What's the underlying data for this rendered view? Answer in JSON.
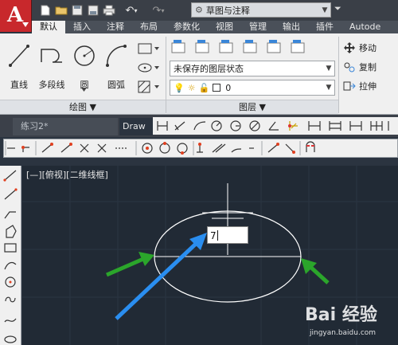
{
  "app": {
    "logo_letter": "A"
  },
  "quick_access": {
    "icons": [
      "new-file-icon",
      "open-folder-icon",
      "save-icon",
      "save-as-icon",
      "print-icon",
      "undo-icon",
      "redo-icon"
    ]
  },
  "workspace": {
    "value": "草图与注释"
  },
  "ribbon_tabs": [
    "默认",
    "插入",
    "注释",
    "布局",
    "参数化",
    "视图",
    "管理",
    "输出",
    "插件",
    "Autode"
  ],
  "draw_panel": {
    "tools": [
      "直线",
      "多段线",
      "圆",
      "圆弧"
    ],
    "title": "绘图 ▼"
  },
  "layers_panel": {
    "layer_state": "未保存的图层状态",
    "current_layer": "0",
    "title": "图层 ▼"
  },
  "modify_panel": {
    "tools": [
      "移动",
      "复制",
      "拉伸"
    ]
  },
  "file_tabs": [
    "练习2*",
    "Draw"
  ],
  "viewport": {
    "label": "[—][俯视][二维线框]"
  },
  "dynamic_input": {
    "value": "7"
  },
  "watermark": {
    "logo": "Bai 经验",
    "url": "jingyan.baidu.com"
  },
  "colors": {
    "accent_red": "#c8282c",
    "canvas": "#212a35",
    "arrow_blue": "#2a8ef0",
    "arrow_green": "#2ba52b"
  }
}
